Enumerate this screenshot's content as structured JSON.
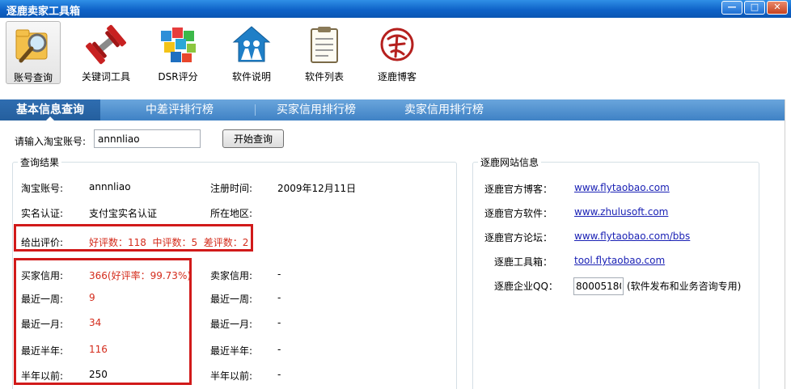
{
  "window": {
    "title": "逐鹿卖家工具箱",
    "buttons": [
      "—",
      "□",
      "✕"
    ]
  },
  "toolbar": {
    "items": [
      {
        "label": "账号查询",
        "icon": "magnifier-folder-icon"
      },
      {
        "label": "关键词工具",
        "icon": "dumbbell-icon"
      },
      {
        "label": "DSR评分",
        "icon": "cubes-icon"
      },
      {
        "label": "软件说明",
        "icon": "home-people-icon"
      },
      {
        "label": "软件列表",
        "icon": "notepad-icon"
      },
      {
        "label": "逐鹿博客",
        "icon": "seal-logo-icon"
      }
    ]
  },
  "tabs": [
    "基本信息查询",
    "中差评排行榜",
    "买家信用排行榜",
    "卖家信用排行榜"
  ],
  "search": {
    "label": "请输入淘宝账号:",
    "value": "annnliao",
    "button": "开始查询"
  },
  "results": {
    "legend": "查询结果",
    "account_label": "淘宝账号:",
    "account_value": "annnliao",
    "reg_label": "注册时间:",
    "reg_value": "2009年12月11日",
    "realname_label": "实名认证:",
    "realname_value": "支付宝实名认证",
    "region_label": "所在地区:",
    "ratings_label": "给出评价:",
    "ratings_value": "好评数：118  中评数：5  差评数：2",
    "buyer": [
      {
        "label": "买家信用:",
        "value": "366(好评率：99.73%)"
      },
      {
        "label": "最近一周:",
        "value": "9"
      },
      {
        "label": "最近一月:",
        "value": "34"
      },
      {
        "label": "最近半年:",
        "value": "116"
      },
      {
        "label": "半年以前:",
        "value": "250"
      }
    ],
    "seller": [
      {
        "label": "卖家信用:",
        "value": "-"
      },
      {
        "label": "最近一周:",
        "value": "-"
      },
      {
        "label": "最近一月:",
        "value": "-"
      },
      {
        "label": "最近半年:",
        "value": "-"
      },
      {
        "label": "半年以前:",
        "value": "-"
      }
    ]
  },
  "site": {
    "legend": "逐鹿网站信息",
    "rows": [
      {
        "label": "逐鹿官方博客：",
        "value": "www.flytaobao.com"
      },
      {
        "label": "逐鹿官方软件：",
        "value": "www.zhulusoft.com"
      },
      {
        "label": "逐鹿官方论坛：",
        "value": "www.flytaobao.com/bbs"
      },
      {
        "label": "逐鹿工具箱：",
        "value": "tool.flytaobao.com"
      }
    ],
    "qq_label": "逐鹿企业QQ：",
    "qq_value": "80005180",
    "qq_note": "(软件发布和业务咨询专用)"
  },
  "colors": {
    "titlebar": "#0f63c8",
    "tabbar": "#3f82c5",
    "highlight_red": "#d11a1a",
    "value_red": "#d42c1c",
    "link": "#1b22b5"
  }
}
